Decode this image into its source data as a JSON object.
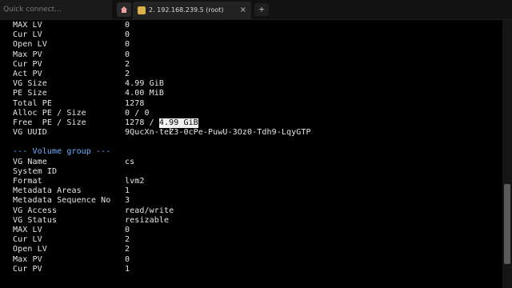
{
  "tabbar": {
    "quick_connect": "Quick connect...",
    "tab_title": "2. 192.168.239.5 (root)",
    "close_symbol": "×",
    "new_tab_symbol": "+"
  },
  "terminal": {
    "rows": [
      {
        "k": "MAX LV",
        "v": "0"
      },
      {
        "k": "Cur LV",
        "v": "0"
      },
      {
        "k": "Open LV",
        "v": "0"
      },
      {
        "k": "Max PV",
        "v": "0"
      },
      {
        "k": "Cur PV",
        "v": "2"
      },
      {
        "k": "Act PV",
        "v": "2"
      },
      {
        "k": "VG Size",
        "v": "4.99 GiB"
      },
      {
        "k": "PE Size",
        "v": "4.00 MiB"
      },
      {
        "k": "Total PE",
        "v": "1278"
      },
      {
        "k": "Alloc PE / Size",
        "v": "0 / 0"
      },
      {
        "k": "Free  PE / Size",
        "v": "1278 / ",
        "sel": "4.99 GiB"
      },
      {
        "k": "VG UUID",
        "v": "9QucXn-teZ3-0cPe-PuwU-3Oz0-Tdh9-LqyGTP"
      }
    ],
    "heading": "--- Volume group ---",
    "rows2": [
      {
        "k": "VG Name",
        "v": "cs"
      },
      {
        "k": "System ID",
        "v": ""
      },
      {
        "k": "Format",
        "v": "lvm2"
      },
      {
        "k": "Metadata Areas",
        "v": "1"
      },
      {
        "k": "Metadata Sequence No",
        "v": "3"
      },
      {
        "k": "VG Access",
        "v": "read/write"
      },
      {
        "k": "VG Status",
        "v": "resizable"
      },
      {
        "k": "MAX LV",
        "v": "0"
      },
      {
        "k": "Cur LV",
        "v": "2"
      },
      {
        "k": "Open LV",
        "v": "2"
      },
      {
        "k": "Max PV",
        "v": "0"
      },
      {
        "k": "Cur PV",
        "v": "1"
      }
    ]
  },
  "colors": {
    "background": "#000000",
    "text": "#e6e6e6",
    "heading": "#6fb3ff",
    "selection": "#f2f2f2"
  }
}
